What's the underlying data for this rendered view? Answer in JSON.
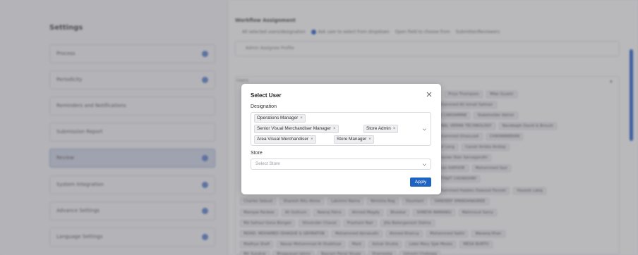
{
  "background": {
    "settings_title": "Settings",
    "menu": [
      {
        "label": "Process"
      },
      {
        "label": "Periodicity"
      },
      {
        "label": "Reminders and Notifications"
      },
      {
        "label": "Submission Report"
      },
      {
        "label": "Review"
      },
      {
        "label": "System Integration"
      },
      {
        "label": "Advance Settings"
      },
      {
        "label": "Language Settings"
      }
    ],
    "workflow_title": "Workflow Assignment",
    "radio_options": [
      "All selected users/designation",
      "Ask user to select from dropdown",
      "Open field to choose from",
      "Submitter/Reviewers"
    ],
    "select_value": "Admin Assignee Profile",
    "users_label": "Users",
    "chip_rows": [
      [
        "Priya Thompson",
        "Mike Gusein"
      ],
      [
        "Mohammed Ali Ismail Salman"
      ],
      [
        "BUJ CARDAMINE",
        "Stakeholder Admin"
      ],
      [
        "SONAL VERMA TECHNOLOGY",
        "Navdeeph David & Broush"
      ],
      [
        "Mohammed Ghaouzali",
        "CHAYANNIEKAN"
      ],
      [
        "Emil Leng",
        "Cassel Ambla Ambay"
      ],
      [
        "Jayasree Stan Sarvagandhi"
      ],
      [
        "Eshan KAPOOR",
        "Mohammed Sazi"
      ],
      [
        "SATYAJIT CHOWDHRY"
      ],
      [
        "Mohammed Hadees Dawood Farooki",
        "Haseeb Lakaj"
      ],
      [
        "Charles Sebust",
        "Sharesh Ritu Ahmo",
        "Lakshmi Narna",
        "Nimisha Rag",
        "Dountant",
        "SANDEEP SPANDANASREE"
      ],
      [
        "Mampal Panbee",
        "Ali Gothum",
        "Neeraj Patra",
        "Ahmed Magdy",
        "Bhaskar",
        "SHREYA RAMANGI",
        "Mahmoud Samy"
      ],
      [
        "Md Safraul Gona Bongen",
        "Shivender Chaval",
        "Prashant Nair",
        "Jilla Balanganesh Dalma"
      ],
      [
        "MOHD. MOHAMED ISHAQUE & GEHRATOB",
        "Mohammed Ajmaludin",
        "Ahmed Khairuy",
        "Mohammed Sakhi",
        "Waseeq Khan"
      ],
      [
        "Madhya Shafi",
        "Navaz Mohammad Al Shaikhzai",
        "Mark",
        "Ashok Shukla",
        "Lokel Mary Sjak Mexes",
        "MESA BURTO"
      ],
      [
        "Mir Sundrar",
        "Bhagyasari Jehmi",
        "Basram Panal Shujar",
        "Shameeka",
        "Ushoshi Chekowa"
      ]
    ]
  },
  "modal": {
    "title": "Select User",
    "designation_label": "Designation",
    "selected_designations": [
      "Operations Manager",
      "Senior Visual Merchandiser Manager",
      "Store Admin",
      "Area Visual Merchandiser",
      "Store Manager"
    ],
    "store_label": "Store",
    "store_placeholder": "Select Store",
    "apply_label": "Apply",
    "remove_glyph": "×"
  },
  "colors": {
    "accent": "#1f63c2",
    "overlay": "rgba(70,70,80,0.38)"
  }
}
